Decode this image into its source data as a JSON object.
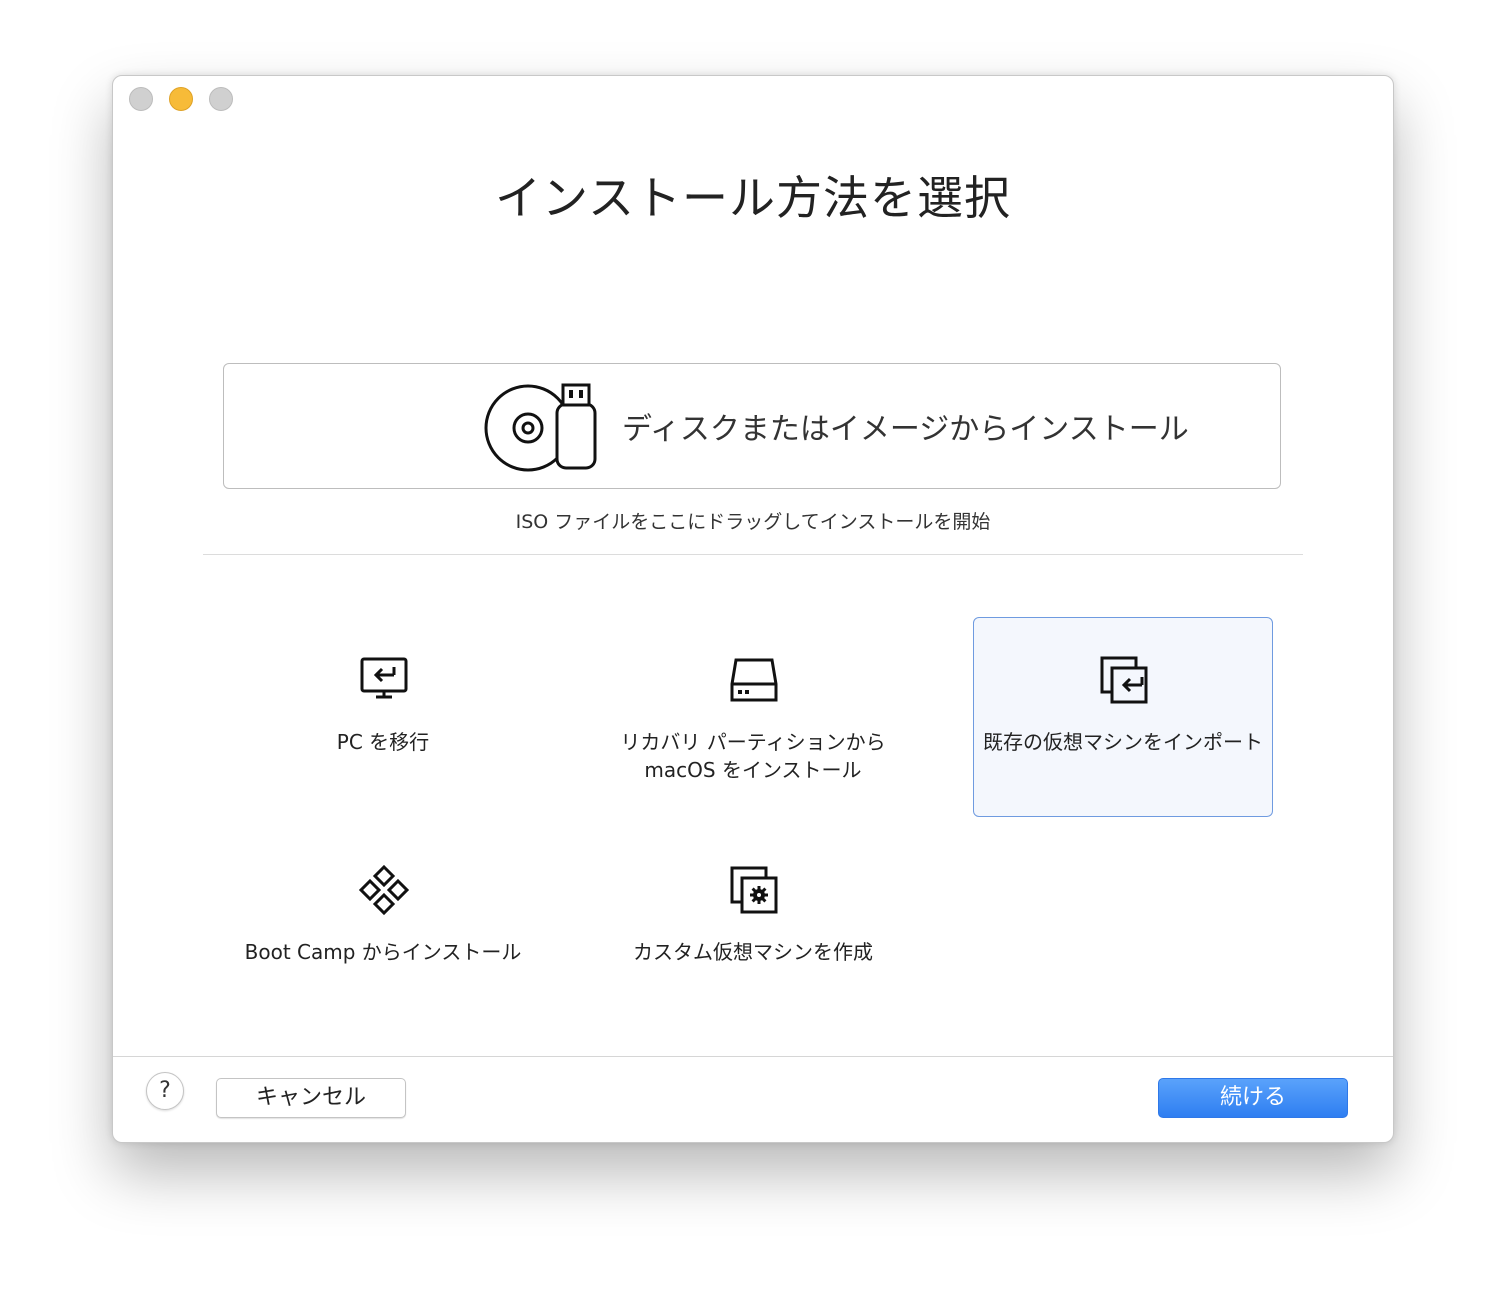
{
  "window": {
    "title": "インストール方法を選択"
  },
  "disk_install": {
    "label": "ディスクまたはイメージからインストール",
    "hint": "ISO ファイルをここにドラッグしてインストールを開始"
  },
  "options": [
    {
      "label": "PC を移行",
      "icon": "pc-migrate-icon"
    },
    {
      "label_line1": "リカバリ パーティションから",
      "label_line2": "macOS をインストール",
      "icon": "hard-drive-icon"
    },
    {
      "label": "既存の仮想マシンをインポート",
      "icon": "import-vm-icon",
      "selected": true
    },
    {
      "label": "Boot Camp からインストール",
      "icon": "boot-camp-icon"
    },
    {
      "label": "カスタム仮想マシンを作成",
      "icon": "custom-vm-icon"
    }
  ],
  "footer": {
    "help_label": "?",
    "cancel_label": "キャンセル",
    "continue_label": "続ける"
  },
  "colors": {
    "accent": "#2e7ef1",
    "selected_bg": "#f4f7fd",
    "selected_border": "#6f9be0",
    "minimize": "#f7bb38"
  }
}
